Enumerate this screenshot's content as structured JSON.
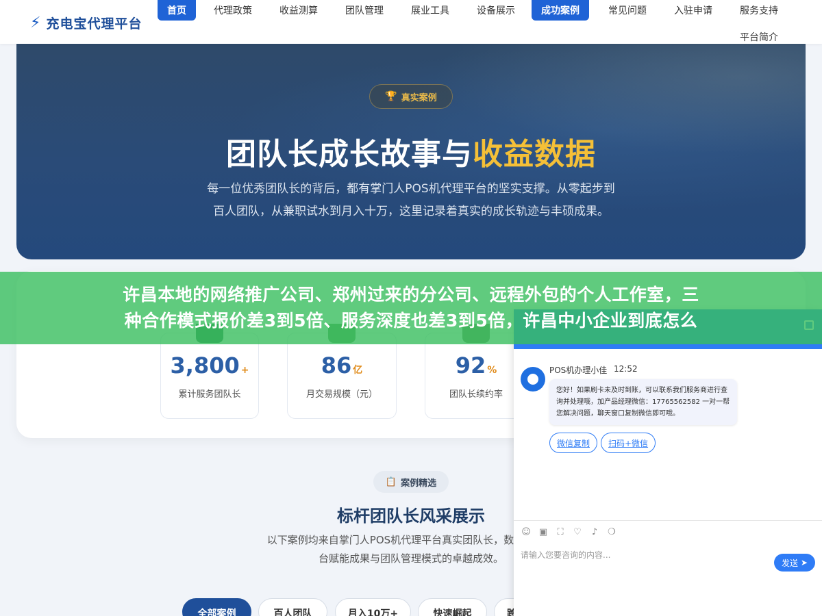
{
  "header": {
    "logo_icon": "⚡",
    "logo_text": "充电宝代理平台",
    "nav": [
      {
        "label": "首页",
        "active": true
      },
      {
        "label": "代理政策"
      },
      {
        "label": "收益测算"
      },
      {
        "label": "团队管理"
      },
      {
        "label": "展业工具"
      },
      {
        "label": "设备展示"
      },
      {
        "label": "成功案例",
        "active": true
      },
      {
        "label": "常见问题"
      },
      {
        "label": "入驻申请"
      },
      {
        "label": "服务支持"
      },
      {
        "label": "平台简介"
      }
    ]
  },
  "hero": {
    "badge": "真实案例",
    "title_main": "团队长成长故事与",
    "title_highlight": "收益数据",
    "description_line1": "每一位优秀团队长的背后，都有掌门人POS机代理平台的坚实支撑。从零起步到",
    "description_line2": "百人团队，从兼职试水到月入十万，这里记录着真实的成长轨迹与丰硕成果。"
  },
  "stats": [
    {
      "value": "3,800",
      "unit": "+",
      "label": "累计服务团队长",
      "color": "#2e8b57"
    },
    {
      "value": "86",
      "unit": "亿",
      "label": "月交易规模（元）",
      "color": "#5aa25a"
    },
    {
      "value": "92",
      "unit": "%",
      "label": "团队长续约率",
      "color": "#6b8f5e"
    }
  ],
  "cases": {
    "badge": "案例精选",
    "title": "标杆团队长风采展示",
    "description_line1": "以下案例均来自掌门人POS机代理平台真实团队长，数据经本人",
    "description_line2": "台赋能成果与团队管理模式的卓越成效。",
    "filters": [
      "全部案例",
      "百人团队",
      "月入10万+",
      "快速崛起",
      "跨"
    ]
  },
  "banner": {
    "line1": "许昌本地的网络推广公司、郑州过来的分公司、远程外包的个人工作室，三",
    "line2": "种合作模式报价差3到5倍、服务深度也差3到5倍，许昌中小企业到底怎么"
  },
  "chat": {
    "agent_name": "POS机办理小佳",
    "time": "12:52",
    "message": "您好！如果刷卡未及时到账，可以联系我们服务商进行查询并处理哦，加产品经理微信：17765562582 一对一帮您解决问题，聊天窗口复制微信即可哦。",
    "buttons": [
      "微信复制",
      "扫码+微信"
    ],
    "tools": [
      "smile-icon",
      "image-icon",
      "crop-icon",
      "heart-icon",
      "sound-icon",
      "bubble-icon"
    ],
    "input_placeholder": "请输入您要咨询的内容...",
    "send_label": "发送"
  },
  "colors": {
    "primary": "#1f63d6",
    "brand": "#1f4f9a",
    "highlight": "#f5c037",
    "banner": "#38be5e",
    "chat": "#2f7cf6"
  }
}
